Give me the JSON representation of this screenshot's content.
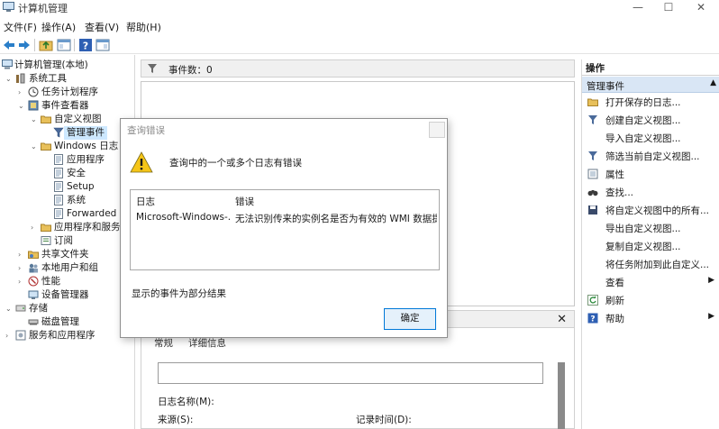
{
  "window": {
    "title": "计算机管理",
    "minimize": "—",
    "maximize": "☐",
    "close": "✕"
  },
  "menu": [
    "文件(F)",
    "操作(A)",
    "查看(V)",
    "帮助(H)"
  ],
  "tree": [
    {
      "label": "计算机管理(本地)",
      "icon": "computer-icon",
      "twisty": ""
    },
    {
      "label": "系统工具",
      "icon": "tools-icon",
      "twisty": "v"
    },
    {
      "label": "任务计划程序",
      "icon": "clock-icon",
      "twisty": ">"
    },
    {
      "label": "事件查看器",
      "icon": "event-viewer-icon",
      "twisty": "v"
    },
    {
      "label": "自定义视图",
      "icon": "folder-icon",
      "twisty": "v"
    },
    {
      "label": "管理事件",
      "icon": "filter-icon",
      "twisty": ""
    },
    {
      "label": "Windows 日志",
      "icon": "folder-icon",
      "twisty": "v"
    },
    {
      "label": "应用程序",
      "icon": "log-icon",
      "twisty": ""
    },
    {
      "label": "安全",
      "icon": "log-icon",
      "twisty": ""
    },
    {
      "label": "Setup",
      "icon": "log-icon",
      "twisty": ""
    },
    {
      "label": "系统",
      "icon": "log-icon",
      "twisty": ""
    },
    {
      "label": "Forwarded E",
      "icon": "log-icon",
      "twisty": ""
    },
    {
      "label": "应用程序和服务",
      "icon": "folder-icon",
      "twisty": ">"
    },
    {
      "label": "订阅",
      "icon": "subscription-icon",
      "twisty": ""
    },
    {
      "label": "共享文件夹",
      "icon": "shared-folder-icon",
      "twisty": ">"
    },
    {
      "label": "本地用户和组",
      "icon": "users-icon",
      "twisty": ">"
    },
    {
      "label": "性能",
      "icon": "performance-icon",
      "twisty": ">"
    },
    {
      "label": "设备管理器",
      "icon": "device-manager-icon",
      "twisty": ""
    },
    {
      "label": "存储",
      "icon": "storage-icon",
      "twisty": "v"
    },
    {
      "label": "磁盘管理",
      "icon": "disk-icon",
      "twisty": ""
    },
    {
      "label": "服务和应用程序",
      "icon": "services-icon",
      "twisty": ">"
    }
  ],
  "center": {
    "event_count": "事件数：0",
    "tab_general": "常规",
    "tab_details": "详细信息",
    "log_name_label": "日志名称(M):",
    "source_label": "来源(S):",
    "logged_label": "记录时间(D):"
  },
  "actions": {
    "title": "操作",
    "section": "管理事件",
    "items": [
      {
        "label": "打开保存的日志...",
        "icon": "open-log-icon",
        "sub": ""
      },
      {
        "label": "创建自定义视图...",
        "icon": "filter-icon",
        "sub": ""
      },
      {
        "label": "导入自定义视图...",
        "icon": "",
        "sub": ""
      },
      {
        "label": "筛选当前自定义视图...",
        "icon": "filter-icon",
        "sub": ""
      },
      {
        "label": "属性",
        "icon": "properties-icon",
        "sub": ""
      },
      {
        "label": "查找...",
        "icon": "binoculars-icon",
        "sub": ""
      },
      {
        "label": "将自定义视图中的所有...",
        "icon": "save-icon",
        "sub": ""
      },
      {
        "label": "导出自定义视图...",
        "icon": "",
        "sub": ""
      },
      {
        "label": "复制自定义视图...",
        "icon": "",
        "sub": ""
      },
      {
        "label": "将任务附加到此自定义...",
        "icon": "",
        "sub": ""
      },
      {
        "label": "查看",
        "icon": "",
        "sub": "▶"
      },
      {
        "label": "刷新",
        "icon": "refresh-icon",
        "sub": ""
      },
      {
        "label": "帮助",
        "icon": "help-icon",
        "sub": "▶"
      }
    ]
  },
  "dialog": {
    "title": "查询错误",
    "message": "查询中的一个或多个日志有错误",
    "col_log": "日志",
    "col_error": "错误",
    "row_log": "Microsoft-Windows-...",
    "row_error": "无法识别传来的实例名是否为有效的 WMI 数据提...",
    "note": "显示的事件为部分结果",
    "ok": "确定"
  },
  "colors": {
    "accent": "#0078d7",
    "section_bg": "#d9e6f5",
    "selection": "#cde8ff"
  }
}
